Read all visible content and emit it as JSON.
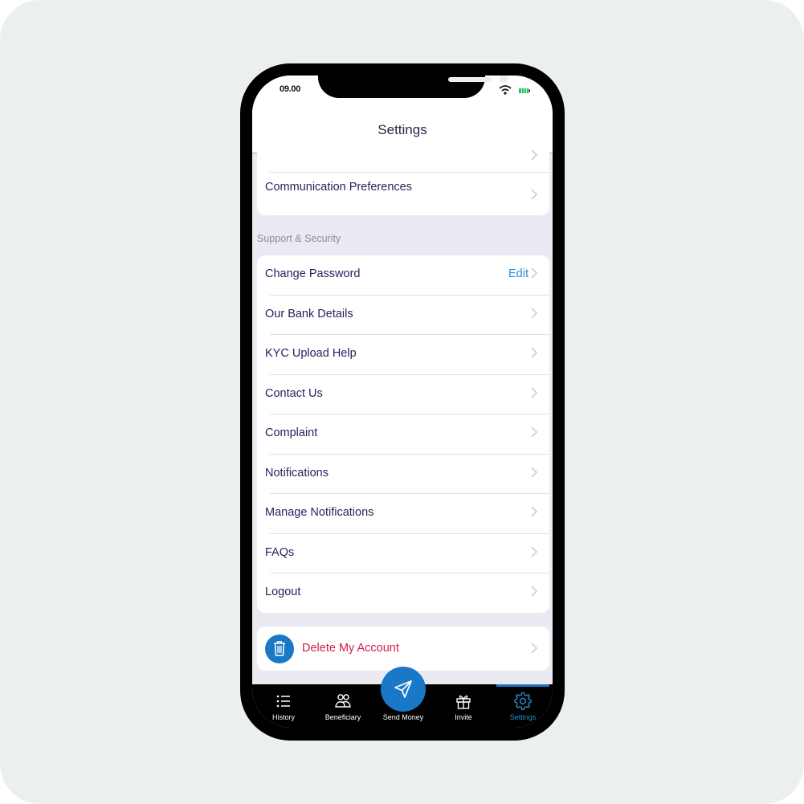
{
  "status_bar": {
    "time": "09.00",
    "wifi_icon": "wifi-icon",
    "battery_icon": "battery-icon",
    "battery_color": "#22c55e"
  },
  "header": {
    "title": "Settings"
  },
  "top_group": {
    "items": [
      {
        "label": "Communication Preferences"
      }
    ]
  },
  "support_section": {
    "title": "Support & Security",
    "items": [
      {
        "label": "Change Password",
        "action": "Edit"
      },
      {
        "label": "Our Bank Details"
      },
      {
        "label": "KYC Upload Help"
      },
      {
        "label": "Contact Us"
      },
      {
        "label": "Complaint"
      },
      {
        "label": "Notifications"
      },
      {
        "label": "Manage Notifications"
      },
      {
        "label": "FAQs"
      },
      {
        "label": "Logout"
      }
    ]
  },
  "danger": {
    "label": "Delete My Account",
    "icon": "trash-icon",
    "color": "#d31b4a"
  },
  "tabbar": {
    "items": [
      {
        "label": "History",
        "icon": "list-icon"
      },
      {
        "label": "Beneficiary",
        "icon": "users-icon"
      },
      {
        "label": "Send Money",
        "icon": "send-icon"
      },
      {
        "label": "Invite",
        "icon": "gift-icon"
      },
      {
        "label": "Settings",
        "icon": "gear-icon",
        "active": true
      }
    ],
    "accent": "#1a79c6"
  }
}
